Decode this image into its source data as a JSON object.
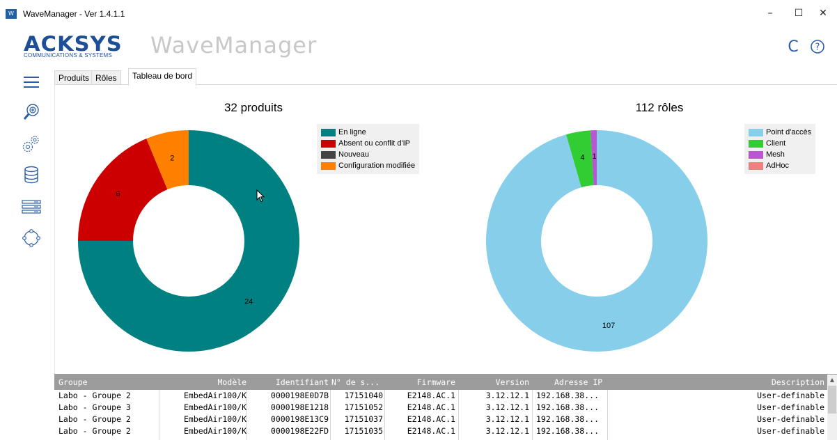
{
  "window": {
    "title": "WaveManager - Ver 1.4.1.1",
    "icon_text": "W",
    "minimize": "–",
    "maximize": "☐",
    "close": "✕"
  },
  "header": {
    "logo": "ACKSYS",
    "logo_sub": "COMMUNICATIONS & SYSTEMS",
    "app_name": "WaveManager",
    "refresh_glyph": "C",
    "help_glyph": "?"
  },
  "tabs": [
    {
      "label": "Produits"
    },
    {
      "label": "Rôles"
    },
    {
      "label": "Tableau de bord"
    }
  ],
  "colors": {
    "online": "#008080",
    "absent": "#cc0000",
    "new": "#444444",
    "modified": "#ff8000",
    "ap": "#87ceeb",
    "client": "#32cd32",
    "mesh": "#ba55d3",
    "adhoc": "#f08080"
  },
  "chart_data": [
    {
      "type": "pie",
      "title": "32 produits",
      "categories": [
        "En ligne",
        "Absent ou conflit d'IP",
        "Nouveau",
        "Configuration modifiée"
      ],
      "values": [
        24,
        6,
        0,
        2
      ],
      "data_labels": [
        "24",
        "6",
        "",
        "2"
      ],
      "legend": "top-right"
    },
    {
      "type": "pie",
      "title": "112 rôles",
      "categories": [
        "Point d'accès",
        "Client",
        "Mesh",
        "AdHoc"
      ],
      "values": [
        107,
        4,
        1,
        0
      ],
      "data_labels": [
        "107",
        "4",
        "1",
        ""
      ],
      "legend": "top-right"
    }
  ],
  "table": {
    "headers": [
      "Groupe",
      "Modèle",
      "Identifiant",
      "N° de s...",
      "Firmware",
      "Version",
      "Adresse IP",
      "Description"
    ],
    "rows": [
      [
        "Labo - Groupe 2",
        "EmbedAir100/K",
        "0000198E0D7B",
        "17151040",
        "E2148.AC.1",
        "3.12.12.1",
        "192.168.38...",
        "User-definable"
      ],
      [
        "Labo - Groupe 3",
        "EmbedAir100/K",
        "0000198E1218",
        "17151052",
        "E2148.AC.1",
        "3.12.12.1",
        "192.168.38...",
        "User-definable"
      ],
      [
        "Labo - Groupe 2",
        "EmbedAir100/K",
        "0000198E13C9",
        "17151037",
        "E2148.AC.1",
        "3.12.12.1",
        "192.168.38...",
        "User-definable"
      ],
      [
        "Labo - Groupe 2",
        "EmbedAir100/K",
        "0000198E22FD",
        "17151035",
        "E2148.AC.1",
        "3.12.12.1",
        "192.168.38...",
        "User-definable"
      ]
    ]
  }
}
